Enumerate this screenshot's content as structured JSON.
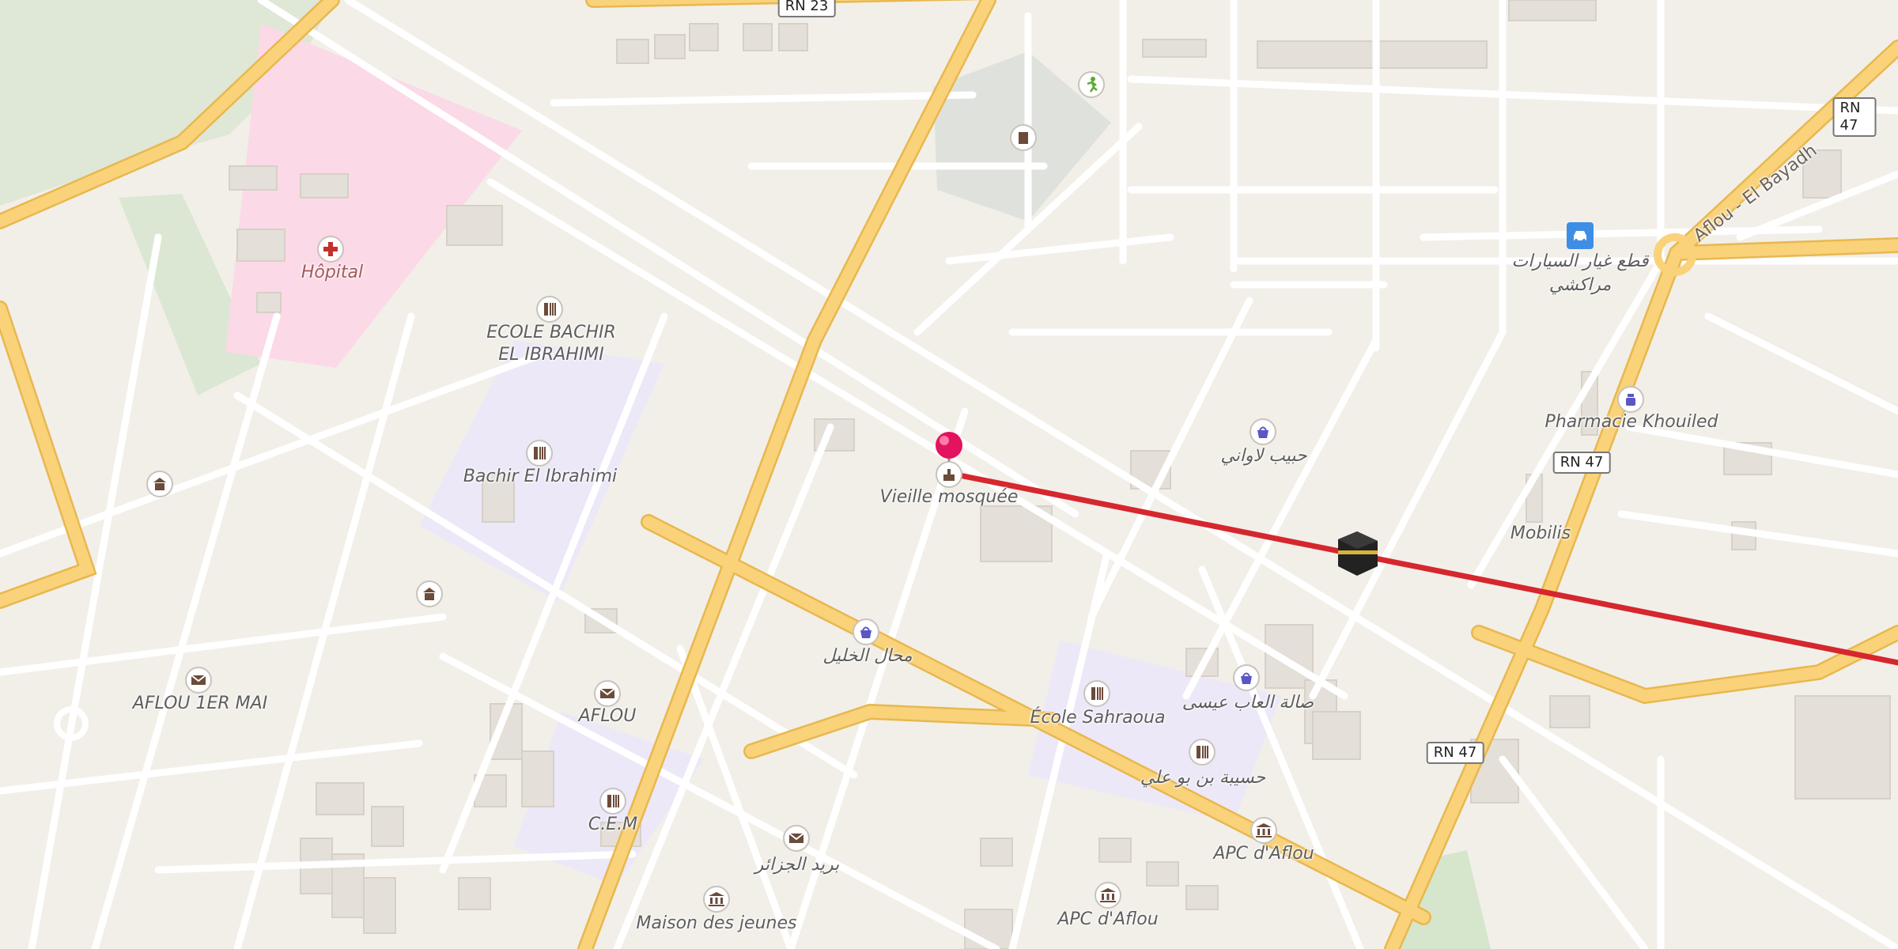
{
  "roads": {
    "rn23": "RN 23",
    "rn47_a": "RN 47",
    "rn47_b": "RN 47",
    "rn47_c": "RN 47",
    "aflou_el_bayadh": "Aflou - El Bayadh"
  },
  "places": {
    "hopital": "Hôpital",
    "ecole_bachir_1": "ECOLE BACHIR",
    "ecole_bachir_2": "EL IBRAHIMI",
    "bachir_el_ibrahimi": "Bachir El Ibrahimi",
    "vieille_mosquee": "Vieille mosquée",
    "aflou_1er_mai": "AFLOU 1ER MAI",
    "aflou": "AFLOU",
    "cem": "C.E.M",
    "maison_des_jeunes": "Maison des jeunes",
    "ecole_sahraoua": "École Sahraoua",
    "apc_aflou_1": "APC d'Aflou",
    "apc_aflou_2": "APC d'Aflou",
    "pharmacie": "Pharmacie Khouiled",
    "mobilis": "Mobilis",
    "car_parts_1": "قطع غيار السيارات",
    "car_parts_2": "مراكشي",
    "habib_lawani": "حبيب لاواني",
    "mahal_khalil": "محال الخليل",
    "salat_alaab": "صالة العاب عيسى",
    "hasibat": "حسيبة بن بو علي",
    "barid": "بريد الجزائر"
  },
  "icons": {
    "hospital": "hospital-cross-icon",
    "school": "school-icon",
    "mosque": "mosque-icon",
    "shop": "shopping-bag-icon",
    "post": "post-envelope-icon",
    "townhall": "townhall-icon",
    "pharmacy": "pharmacy-icon",
    "car": "car-icon",
    "sport": "running-icon",
    "pin": "location-pin-icon",
    "kaaba": "kaaba-icon"
  },
  "colors": {
    "background": "#f2efe9",
    "major_road": "#f9d27a",
    "minor_road": "#ffffff",
    "hospital_area": "#fcd9e7",
    "school_area": "#ece8f8",
    "park": "#d9e8d2",
    "qibla_line": "#d6262e",
    "pin": "#e4135f"
  }
}
